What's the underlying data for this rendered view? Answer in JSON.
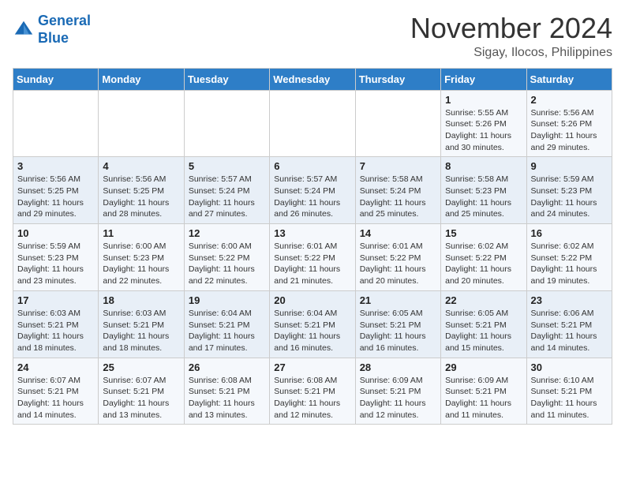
{
  "header": {
    "logo_line1": "General",
    "logo_line2": "Blue",
    "month": "November 2024",
    "location": "Sigay, Ilocos, Philippines"
  },
  "weekdays": [
    "Sunday",
    "Monday",
    "Tuesday",
    "Wednesday",
    "Thursday",
    "Friday",
    "Saturday"
  ],
  "weeks": [
    [
      {
        "day": "",
        "info": ""
      },
      {
        "day": "",
        "info": ""
      },
      {
        "day": "",
        "info": ""
      },
      {
        "day": "",
        "info": ""
      },
      {
        "day": "",
        "info": ""
      },
      {
        "day": "1",
        "info": "Sunrise: 5:55 AM\nSunset: 5:26 PM\nDaylight: 11 hours\nand 30 minutes."
      },
      {
        "day": "2",
        "info": "Sunrise: 5:56 AM\nSunset: 5:26 PM\nDaylight: 11 hours\nand 29 minutes."
      }
    ],
    [
      {
        "day": "3",
        "info": "Sunrise: 5:56 AM\nSunset: 5:25 PM\nDaylight: 11 hours\nand 29 minutes."
      },
      {
        "day": "4",
        "info": "Sunrise: 5:56 AM\nSunset: 5:25 PM\nDaylight: 11 hours\nand 28 minutes."
      },
      {
        "day": "5",
        "info": "Sunrise: 5:57 AM\nSunset: 5:24 PM\nDaylight: 11 hours\nand 27 minutes."
      },
      {
        "day": "6",
        "info": "Sunrise: 5:57 AM\nSunset: 5:24 PM\nDaylight: 11 hours\nand 26 minutes."
      },
      {
        "day": "7",
        "info": "Sunrise: 5:58 AM\nSunset: 5:24 PM\nDaylight: 11 hours\nand 25 minutes."
      },
      {
        "day": "8",
        "info": "Sunrise: 5:58 AM\nSunset: 5:23 PM\nDaylight: 11 hours\nand 25 minutes."
      },
      {
        "day": "9",
        "info": "Sunrise: 5:59 AM\nSunset: 5:23 PM\nDaylight: 11 hours\nand 24 minutes."
      }
    ],
    [
      {
        "day": "10",
        "info": "Sunrise: 5:59 AM\nSunset: 5:23 PM\nDaylight: 11 hours\nand 23 minutes."
      },
      {
        "day": "11",
        "info": "Sunrise: 6:00 AM\nSunset: 5:23 PM\nDaylight: 11 hours\nand 22 minutes."
      },
      {
        "day": "12",
        "info": "Sunrise: 6:00 AM\nSunset: 5:22 PM\nDaylight: 11 hours\nand 22 minutes."
      },
      {
        "day": "13",
        "info": "Sunrise: 6:01 AM\nSunset: 5:22 PM\nDaylight: 11 hours\nand 21 minutes."
      },
      {
        "day": "14",
        "info": "Sunrise: 6:01 AM\nSunset: 5:22 PM\nDaylight: 11 hours\nand 20 minutes."
      },
      {
        "day": "15",
        "info": "Sunrise: 6:02 AM\nSunset: 5:22 PM\nDaylight: 11 hours\nand 20 minutes."
      },
      {
        "day": "16",
        "info": "Sunrise: 6:02 AM\nSunset: 5:22 PM\nDaylight: 11 hours\nand 19 minutes."
      }
    ],
    [
      {
        "day": "17",
        "info": "Sunrise: 6:03 AM\nSunset: 5:21 PM\nDaylight: 11 hours\nand 18 minutes."
      },
      {
        "day": "18",
        "info": "Sunrise: 6:03 AM\nSunset: 5:21 PM\nDaylight: 11 hours\nand 18 minutes."
      },
      {
        "day": "19",
        "info": "Sunrise: 6:04 AM\nSunset: 5:21 PM\nDaylight: 11 hours\nand 17 minutes."
      },
      {
        "day": "20",
        "info": "Sunrise: 6:04 AM\nSunset: 5:21 PM\nDaylight: 11 hours\nand 16 minutes."
      },
      {
        "day": "21",
        "info": "Sunrise: 6:05 AM\nSunset: 5:21 PM\nDaylight: 11 hours\nand 16 minutes."
      },
      {
        "day": "22",
        "info": "Sunrise: 6:05 AM\nSunset: 5:21 PM\nDaylight: 11 hours\nand 15 minutes."
      },
      {
        "day": "23",
        "info": "Sunrise: 6:06 AM\nSunset: 5:21 PM\nDaylight: 11 hours\nand 14 minutes."
      }
    ],
    [
      {
        "day": "24",
        "info": "Sunrise: 6:07 AM\nSunset: 5:21 PM\nDaylight: 11 hours\nand 14 minutes."
      },
      {
        "day": "25",
        "info": "Sunrise: 6:07 AM\nSunset: 5:21 PM\nDaylight: 11 hours\nand 13 minutes."
      },
      {
        "day": "26",
        "info": "Sunrise: 6:08 AM\nSunset: 5:21 PM\nDaylight: 11 hours\nand 13 minutes."
      },
      {
        "day": "27",
        "info": "Sunrise: 6:08 AM\nSunset: 5:21 PM\nDaylight: 11 hours\nand 12 minutes."
      },
      {
        "day": "28",
        "info": "Sunrise: 6:09 AM\nSunset: 5:21 PM\nDaylight: 11 hours\nand 12 minutes."
      },
      {
        "day": "29",
        "info": "Sunrise: 6:09 AM\nSunset: 5:21 PM\nDaylight: 11 hours\nand 11 minutes."
      },
      {
        "day": "30",
        "info": "Sunrise: 6:10 AM\nSunset: 5:21 PM\nDaylight: 11 hours\nand 11 minutes."
      }
    ]
  ]
}
